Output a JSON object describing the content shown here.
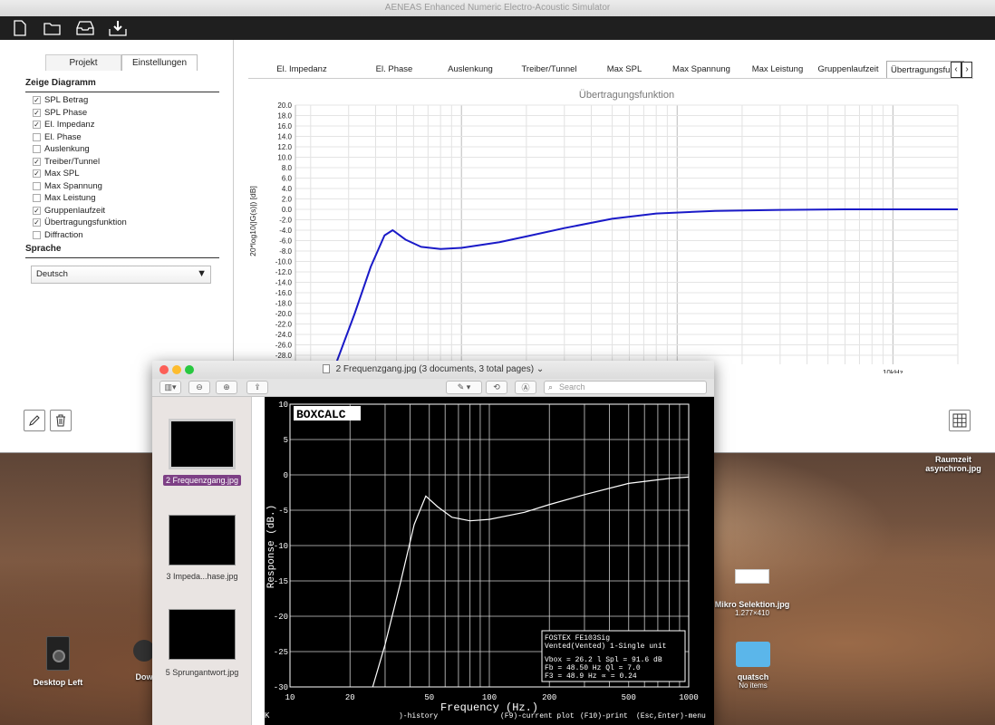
{
  "app": {
    "title": "AENEAS Enhanced Numeric Electro-Acoustic Simulator",
    "left_tabs": [
      "Projekt",
      "Einstellungen"
    ],
    "section_diagram": "Zeige Diagramm",
    "checkboxes": [
      {
        "label": "SPL Betrag",
        "checked": true
      },
      {
        "label": "SPL Phase",
        "checked": true
      },
      {
        "label": "El. Impedanz",
        "checked": true
      },
      {
        "label": "El. Phase",
        "checked": false
      },
      {
        "label": "Auslenkung",
        "checked": false
      },
      {
        "label": "Treiber/Tunnel",
        "checked": true
      },
      {
        "label": "Max SPL",
        "checked": true
      },
      {
        "label": "Max Spannung",
        "checked": false
      },
      {
        "label": "Max Leistung",
        "checked": false
      },
      {
        "label": "Gruppenlaufzeit",
        "checked": true
      },
      {
        "label": "Übertragungsfunktion",
        "checked": true
      },
      {
        "label": "Diffraction",
        "checked": false
      }
    ],
    "section_language": "Sprache",
    "language_value": "Deutsch",
    "diagram_tabs": [
      "El. Impedanz",
      "El. Phase",
      "Auslenkung",
      "Treiber/Tunnel",
      "Max SPL",
      "Max Spannung",
      "Max Leistung",
      "Gruppenlaufzeit",
      "Übertragungsfun.."
    ],
    "active_tab_index": 8
  },
  "chart_data": [
    {
      "type": "line",
      "title": "Übertragungsfunktion",
      "ylabel": "20*log10(|G(s)|) [dB]",
      "xlabel": "",
      "ylim": [
        -30,
        20
      ],
      "y_ticks": [
        "20.0",
        "18.0",
        "16.0",
        "14.0",
        "12.0",
        "10.0",
        "8.0",
        "6.0",
        "4.0",
        "2.0",
        "0.0",
        "-2.0",
        "-4.0",
        "-6.0",
        "-8.0",
        "-10.0",
        "-12.0",
        "-14.0",
        "-16.0",
        "-18.0",
        "-20.0",
        "-22.0",
        "-24.0",
        "-26.0",
        "-28.0"
      ],
      "x_tick_label": "10kHz",
      "x_scale": "log",
      "grid": true,
      "series": [
        {
          "color": "#1a1ac8",
          "x": [
            26,
            32,
            38,
            44,
            48,
            55,
            65,
            80,
            100,
            150,
            200,
            300,
            500,
            800,
            1500,
            3000,
            6000,
            20000
          ],
          "y": [
            -30,
            -20,
            -11,
            -5,
            -4.0,
            -5.8,
            -7.2,
            -7.6,
            -7.4,
            -6.3,
            -5.2,
            -3.6,
            -1.8,
            -0.8,
            -0.3,
            -0.1,
            0,
            0
          ]
        }
      ]
    },
    {
      "type": "line",
      "title": "",
      "ylabel": "Response (dB.)",
      "xlabel": "Frequency (Hz.)",
      "ylim": [
        -30,
        10
      ],
      "y_ticks": [
        "10",
        "5",
        "0",
        "-5",
        "-10",
        "-15",
        "-20",
        "-25",
        "-30"
      ],
      "x_ticks": [
        "10",
        "20",
        "50",
        "100",
        "200",
        "500",
        "1000"
      ],
      "x_scale": "log",
      "grid": true,
      "series": [
        {
          "color": "#ffffff",
          "x": [
            26,
            30,
            36,
            42,
            48,
            55,
            65,
            80,
            100,
            150,
            200,
            300,
            500,
            800,
            1000
          ],
          "y": [
            -30,
            -24,
            -15,
            -7,
            -3.0,
            -4.5,
            -6.0,
            -6.5,
            -6.3,
            -5.3,
            -4.2,
            -2.8,
            -1.2,
            -0.5,
            -0.3
          ]
        }
      ]
    }
  ],
  "preview": {
    "title": "2  Frequenzgang.jpg (3 documents, 3 total pages)",
    "search_placeholder": "Search",
    "thumbs": [
      "2  Frequenzgang.jpg",
      "3 Impeda...hase.jpg",
      "5 Sprungantwort.jpg"
    ],
    "plot_header": "BOXCALC",
    "info_title": "FOSTEX FE103Sig",
    "info_sub": "Vented(Vented) 1-Single unit",
    "info_rows": [
      "Vbox =   26.2 l     Spl  =  91.6 dB",
      "Fb   =  48.50 Hz     Ql  =   7.0",
      "F3   =   48.9 Hz     ∝   =   0.24"
    ],
    "footer": [
      ")-history",
      "(F9)-current plot",
      "(F10)-print",
      "(Esc,Enter)-menu"
    ],
    "footer_left": "K"
  },
  "desktop": {
    "icons": [
      {
        "label": "Raumzeit asynchron.jpg",
        "sub": ""
      },
      {
        "label": "Mikro Selektion.jpg",
        "sub": "1.277×410"
      },
      {
        "label": "quatsch",
        "sub": "No items"
      },
      {
        "label": "Desktop Left",
        "sub": ""
      },
      {
        "label": "Dow",
        "sub": ""
      }
    ]
  }
}
